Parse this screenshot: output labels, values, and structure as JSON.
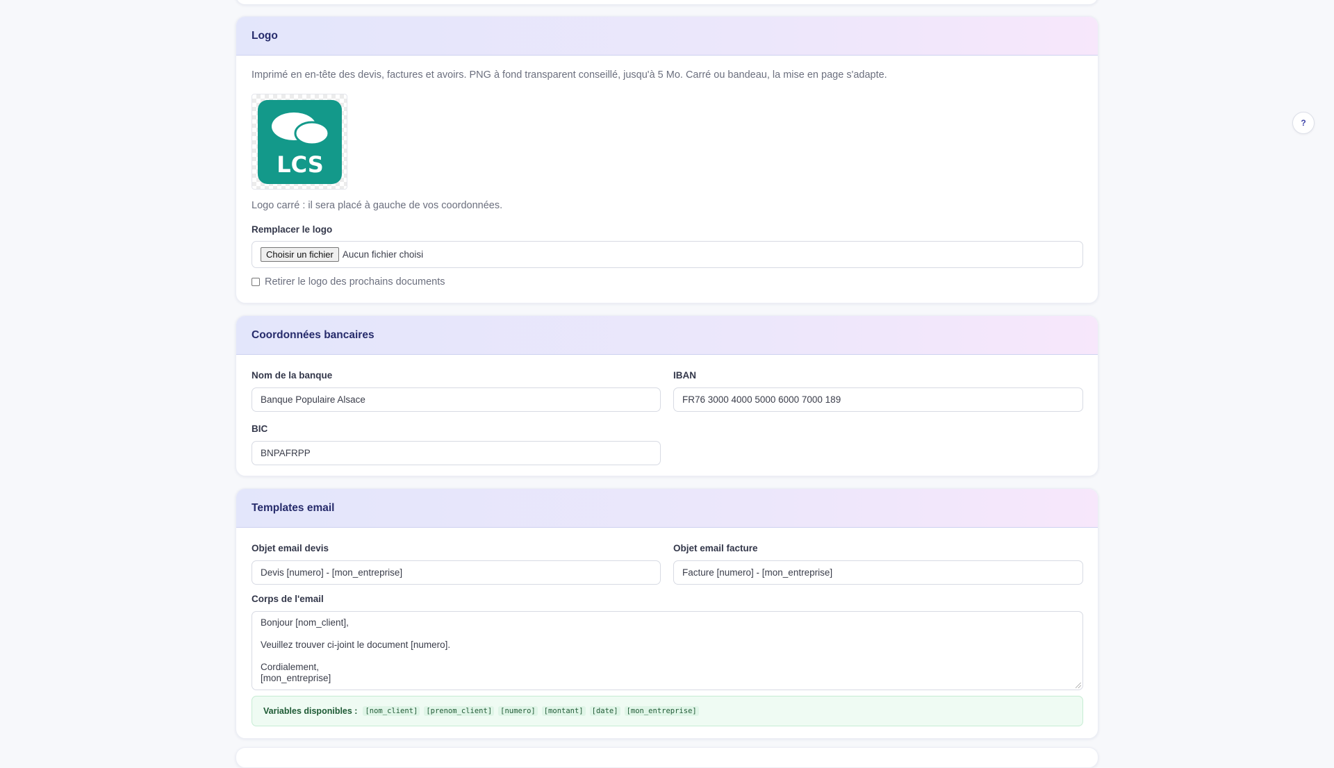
{
  "logo_section": {
    "title": "Logo",
    "description": "Imprimé en en-tête des devis, factures et avoirs. PNG à fond transparent conseillé, jusqu'à 5 Mo. Carré ou bandeau, la mise en page s'adapte.",
    "logo_text": "LCS",
    "logo_color": "#13998a",
    "placement_note": "Logo carré : il sera placé à gauche de vos coordonnées.",
    "replace_label": "Remplacer le logo",
    "file_button_label": "Choisir un fichier",
    "file_status": "Aucun fichier choisi",
    "remove_checkbox_label": "Retirer le logo des prochains documents"
  },
  "bank_section": {
    "title": "Coordonnées bancaires",
    "bank_name_label": "Nom de la banque",
    "bank_name_value": "Banque Populaire Alsace",
    "iban_label": "IBAN",
    "iban_value": "FR76 3000 4000 5000 6000 7000 189",
    "bic_label": "BIC",
    "bic_value": "BNPAFRPP"
  },
  "email_section": {
    "title": "Templates email",
    "quote_subject_label": "Objet email devis",
    "quote_subject_value": "Devis [numero] - [mon_entreprise]",
    "invoice_subject_label": "Objet email facture",
    "invoice_subject_value": "Facture [numero] - [mon_entreprise]",
    "body_label": "Corps de l'email",
    "body_lines": [
      "Bonjour [nom_client],",
      "",
      "Veuillez trouver ci-joint le document [numero].",
      "",
      "Cordialement,",
      "[mon_entreprise]"
    ],
    "variables_label": "Variables disponibles :",
    "variables": [
      "[nom_client]",
      "[prenom_client]",
      "[numero]",
      "[montant]",
      "[date]",
      "[mon_entreprise]"
    ]
  },
  "help_button": {
    "label": "?"
  },
  "colors": {
    "page_bg": "#f7f8fb",
    "section_title": "#262b6b",
    "accent": "#3e43a8",
    "variables_bg": "#effbf3"
  }
}
